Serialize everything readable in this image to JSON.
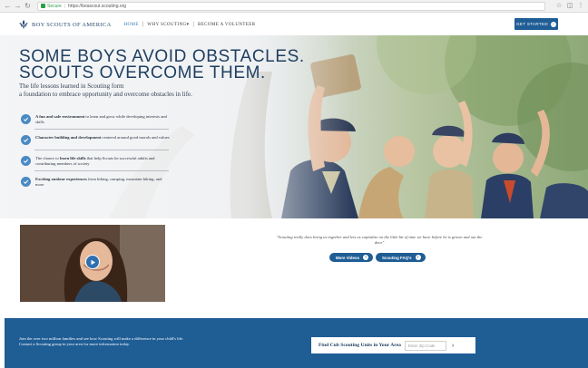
{
  "browser": {
    "secure_label": "Secure",
    "url": "https://beascout.scouting.org"
  },
  "header": {
    "logo_text": "BOY SCOUTS OF AMERICA",
    "nav": [
      {
        "label": "HOME"
      },
      {
        "label": "WHY SCOUTING"
      },
      {
        "label": "BECOME A VOLUNTEER"
      }
    ],
    "nav_dropdown_glyph": "▾",
    "cta_label": "GET STARTED"
  },
  "hero": {
    "headline_line1": "SOME BOYS AVOID OBSTACLES.",
    "headline_line2": "SCOUTS OVERCOME THEM.",
    "subhead_line1": "The life lessons learned in Scouting form",
    "subhead_line2": "a foundation to embrace opportunity and overcome obstacles in life.",
    "features": [
      {
        "bold": "A fun and safe environment",
        "rest": " to learn and grow while developing interests and skills",
        "bold_first": true
      },
      {
        "bold": "Character building and development",
        "rest": " centered around good morals and values",
        "bold_first": true
      },
      {
        "pre": "The chance to ",
        "bold": "learn life skills",
        "rest": " that help Scouts be successful adults and contributing members of society"
      },
      {
        "bold": "Exciting outdoor experiences",
        "rest": " from hiking, camping, mountain biking, and more",
        "bold_first": true
      }
    ]
  },
  "media": {
    "quote": "\"Scouting really does bring us together and lets us capitalize on the little bit of time we have before he is grown and out the door\"",
    "buttons": [
      {
        "label": "More Videos"
      },
      {
        "label": "Scouting FAQ's"
      }
    ]
  },
  "band": {
    "text": "Join the over two million families and see how Scouting will make a difference in your child's life. Contact a Scouting group in your area for more information today.",
    "finder_label": "Find Cub Scouting Units in Your Area",
    "zip_placeholder": "Enter Zip Code",
    "go_glyph": "›"
  },
  "colors": {
    "brand_blue": "#1f5d95",
    "headline_navy": "#1f3f62",
    "check_blue": "#4a8ac4"
  }
}
